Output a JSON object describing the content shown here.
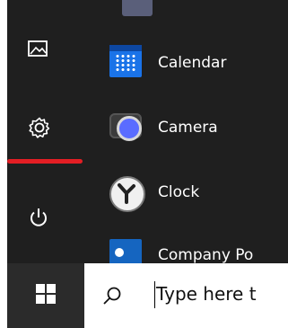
{
  "start_menu": {
    "rail": {
      "items": [
        {
          "name": "pictures"
        },
        {
          "name": "settings"
        },
        {
          "name": "power"
        }
      ]
    },
    "apps": [
      {
        "label": "Calendar",
        "icon": "calendar-icon",
        "color": "#1a73e8"
      },
      {
        "label": "Camera",
        "icon": "camera-icon",
        "color": "#3b3b3b"
      },
      {
        "label": "Clock",
        "icon": "clock-icon",
        "color": "#6f6f6f"
      },
      {
        "label": "Company Po",
        "icon": "company-portal-icon",
        "color": "#1565c0"
      }
    ]
  },
  "taskbar": {
    "search_placeholder": "Type here t"
  },
  "colors": {
    "menu_background": "#1f1f1f",
    "accent_underline": "#e31e24",
    "taskbar_start": "#2b2b2b"
  }
}
